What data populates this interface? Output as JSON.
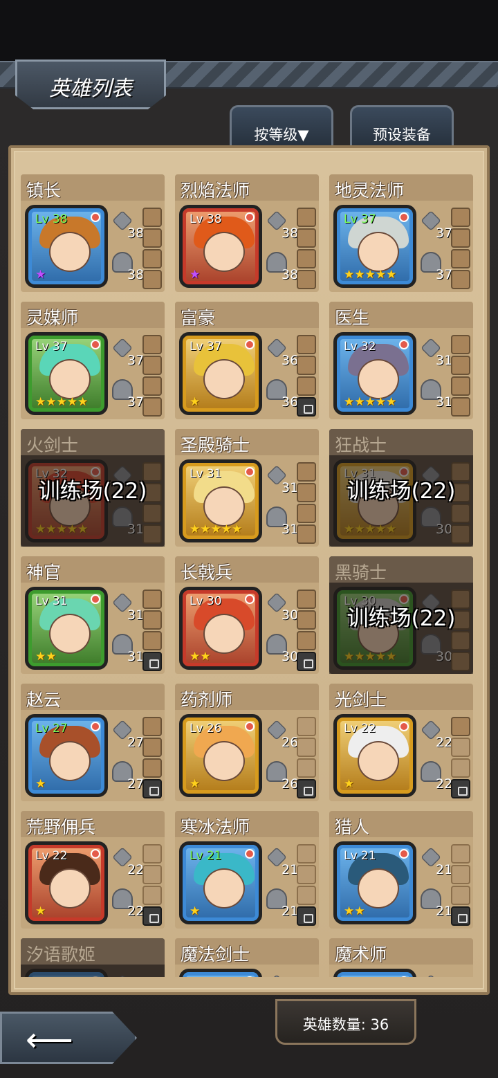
{
  "header": {
    "title": "英雄列表"
  },
  "tabs": {
    "sort_label": "按等级▼",
    "preset_label": "预设装备"
  },
  "footer": {
    "hero_count": "英雄数量: 36"
  },
  "back_icon": "left-arrow-icon",
  "heroes": [
    {
      "name": "镇长",
      "level": "Lv 38",
      "atk": "38",
      "def": "38",
      "stars": "★",
      "star_color": "purple",
      "frame": "blue",
      "hair": "#c8782a",
      "locked": false,
      "lock_text": "",
      "eq": [
        "item",
        "item",
        "item",
        "item"
      ]
    },
    {
      "name": "烈焰法师",
      "level": "Lv 38",
      "atk": "38",
      "def": "38",
      "stars": "★",
      "star_color": "purple",
      "frame": "red",
      "hair": "#e05a1a",
      "locked": false,
      "lock_text": "",
      "eq": [
        "item",
        "item",
        "item",
        "item"
      ]
    },
    {
      "name": "地灵法师",
      "level": "Lv 37",
      "atk": "37",
      "def": "37",
      "stars": "★★★★★",
      "star_color": "gold",
      "frame": "blue",
      "hair": "#cfd6d2",
      "locked": false,
      "lock_text": "",
      "eq": [
        "item",
        "item",
        "item",
        "item"
      ]
    },
    {
      "name": "灵媒师",
      "level": "Lv 37",
      "atk": "37",
      "def": "37",
      "stars": "★★★★★",
      "star_color": "gold",
      "frame": "green",
      "hair": "#5ad6b8",
      "locked": false,
      "lock_text": "",
      "eq": [
        "item",
        "item",
        "item",
        "item"
      ]
    },
    {
      "name": "富豪",
      "level": "Lv 37",
      "atk": "36",
      "def": "36",
      "stars": "★",
      "star_color": "gold",
      "frame": "gold",
      "hair": "#e8c23a",
      "locked": false,
      "lock_text": "",
      "eq": [
        "item",
        "item",
        "item",
        "lock"
      ]
    },
    {
      "name": "医生",
      "level": "Lv 32",
      "atk": "31",
      "def": "31",
      "stars": "★★★★★",
      "star_color": "gold",
      "frame": "blue",
      "hair": "#7a7090",
      "locked": false,
      "lock_text": "",
      "eq": [
        "item",
        "item",
        "item",
        "item"
      ]
    },
    {
      "name": "火剑士",
      "level": "Lv 32",
      "atk": "",
      "def": "31",
      "stars": "★★★★★",
      "star_color": "gold",
      "frame": "red",
      "hair": "#d8402a",
      "locked": true,
      "lock_text": "训练场(22)",
      "eq": [
        "item",
        "item",
        "item",
        "item"
      ]
    },
    {
      "name": "圣殿骑士",
      "level": "Lv 31",
      "atk": "31",
      "def": "31",
      "stars": "★★★★★",
      "star_color": "gold",
      "frame": "gold",
      "hair": "#f2dc8a",
      "locked": false,
      "lock_text": "",
      "eq": [
        "item",
        "item",
        "item",
        "item"
      ]
    },
    {
      "name": "狂战士",
      "level": "Lv 31",
      "atk": "",
      "def": "30",
      "stars": "★★★★★",
      "star_color": "gold",
      "frame": "gold",
      "hair": "#e8e4dc",
      "locked": true,
      "lock_text": "训练场(22)",
      "eq": [
        "item",
        "item",
        "item",
        "item"
      ]
    },
    {
      "name": "神官",
      "level": "Lv 31",
      "atk": "31",
      "def": "31",
      "stars": "★★",
      "star_color": "gold",
      "frame": "green",
      "hair": "#6ad6b0",
      "locked": false,
      "lock_text": "",
      "eq": [
        "item",
        "item",
        "item",
        "lock"
      ]
    },
    {
      "name": "长戟兵",
      "level": "Lv 30",
      "atk": "30",
      "def": "30",
      "stars": "★★",
      "star_color": "gold",
      "frame": "red",
      "hair": "#d84a2a",
      "locked": false,
      "lock_text": "",
      "eq": [
        "item",
        "item",
        "item",
        "lock"
      ]
    },
    {
      "name": "黑骑士",
      "level": "Lv 30",
      "atk": "",
      "def": "30",
      "stars": "★★★★★",
      "star_color": "gold",
      "frame": "green",
      "hair": "#c8c8c8",
      "locked": true,
      "lock_text": "训练场(22)",
      "eq": [
        "item",
        "item",
        "item",
        "item"
      ]
    },
    {
      "name": "赵云",
      "level": "Lv 27",
      "atk": "27",
      "def": "27",
      "stars": "★",
      "star_color": "gold",
      "frame": "blue",
      "hair": "#a8502a",
      "locked": false,
      "lock_text": "",
      "eq": [
        "item",
        "item",
        "item",
        "lock"
      ]
    },
    {
      "name": "药剂师",
      "level": "Lv 26",
      "atk": "26",
      "def": "26",
      "stars": "★",
      "star_color": "gold",
      "frame": "gold",
      "hair": "#f0a850",
      "locked": false,
      "lock_text": "",
      "eq": [
        "empty",
        "empty",
        "empty",
        "lock"
      ]
    },
    {
      "name": "光剑士",
      "level": "Lv 22",
      "atk": "22",
      "def": "22",
      "stars": "★",
      "star_color": "gold",
      "frame": "gold",
      "hair": "#eeeeee",
      "locked": false,
      "lock_text": "",
      "eq": [
        "item",
        "empty",
        "empty",
        "lock"
      ]
    },
    {
      "name": "荒野佣兵",
      "level": "Lv 22",
      "atk": "22",
      "def": "22",
      "stars": "★",
      "star_color": "gold",
      "frame": "red",
      "hair": "#4a2a1a",
      "locked": false,
      "lock_text": "",
      "eq": [
        "empty",
        "empty",
        "empty",
        "lock"
      ]
    },
    {
      "name": "寒冰法师",
      "level": "Lv 21",
      "atk": "21",
      "def": "21",
      "stars": "★",
      "star_color": "gold",
      "frame": "blue",
      "hair": "#3ab8c8",
      "locked": false,
      "lock_text": "",
      "eq": [
        "empty",
        "empty",
        "empty",
        "lock"
      ]
    },
    {
      "name": "猎人",
      "level": "Lv 21",
      "atk": "21",
      "def": "21",
      "stars": "★★",
      "star_color": "gold",
      "frame": "blue",
      "hair": "#2a5a7a",
      "locked": false,
      "lock_text": "",
      "eq": [
        "empty",
        "empty",
        "empty",
        "lock"
      ]
    },
    {
      "name": "汐语歌姬",
      "level": "",
      "atk": "",
      "def": "",
      "stars": "",
      "star_color": "gold",
      "frame": "blue",
      "hair": "#6a9ad6",
      "locked": true,
      "lock_text": "",
      "eq": []
    },
    {
      "name": "魔法剑士",
      "level": "",
      "atk": "",
      "def": "",
      "stars": "",
      "star_color": "gold",
      "frame": "blue",
      "hair": "#6a4ad6",
      "locked": false,
      "lock_text": "",
      "eq": []
    },
    {
      "name": "魔术师",
      "level": "",
      "atk": "",
      "def": "",
      "stars": "",
      "star_color": "gold",
      "frame": "blue",
      "hair": "#3a3a6a",
      "locked": false,
      "lock_text": "",
      "eq": []
    }
  ]
}
